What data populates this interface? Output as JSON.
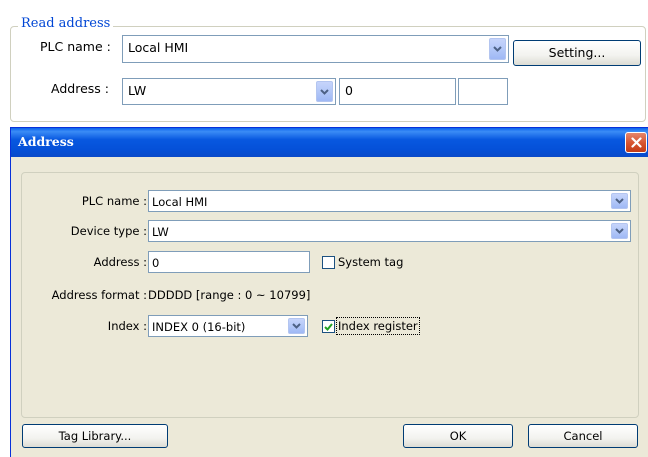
{
  "read_address": {
    "group_title": "Read address",
    "plc_name_label": "PLC name :",
    "plc_name_value": "Local HMI",
    "setting_label": "Setting...",
    "address_label": "Address :",
    "device_value": "LW",
    "address_value": "0"
  },
  "dialog": {
    "title": "Address",
    "plc_name_label": "PLC name :",
    "plc_name_value": "Local HMI",
    "device_type_label": "Device type :",
    "device_type_value": "LW",
    "address_label": "Address :",
    "address_value": "0",
    "system_tag_label": "System tag",
    "system_tag_checked": false,
    "address_format_label": "Address format :",
    "address_format_value": "DDDDD [range : 0 ~ 10799]",
    "index_label": "Index :",
    "index_value": "INDEX 0 (16-bit)",
    "index_register_label": "Index register",
    "index_register_checked": true,
    "tag_library_label": "Tag Library...",
    "ok_label": "OK",
    "cancel_label": "Cancel"
  },
  "icons": {
    "dropdown": "chevron-down-icon",
    "close": "close-icon",
    "check": "check-icon"
  },
  "colors": {
    "title_bar": "#0858e0",
    "group_title": "#0046d5",
    "dialog_bg": "#ece9d8",
    "close_button": "#d6532f"
  }
}
